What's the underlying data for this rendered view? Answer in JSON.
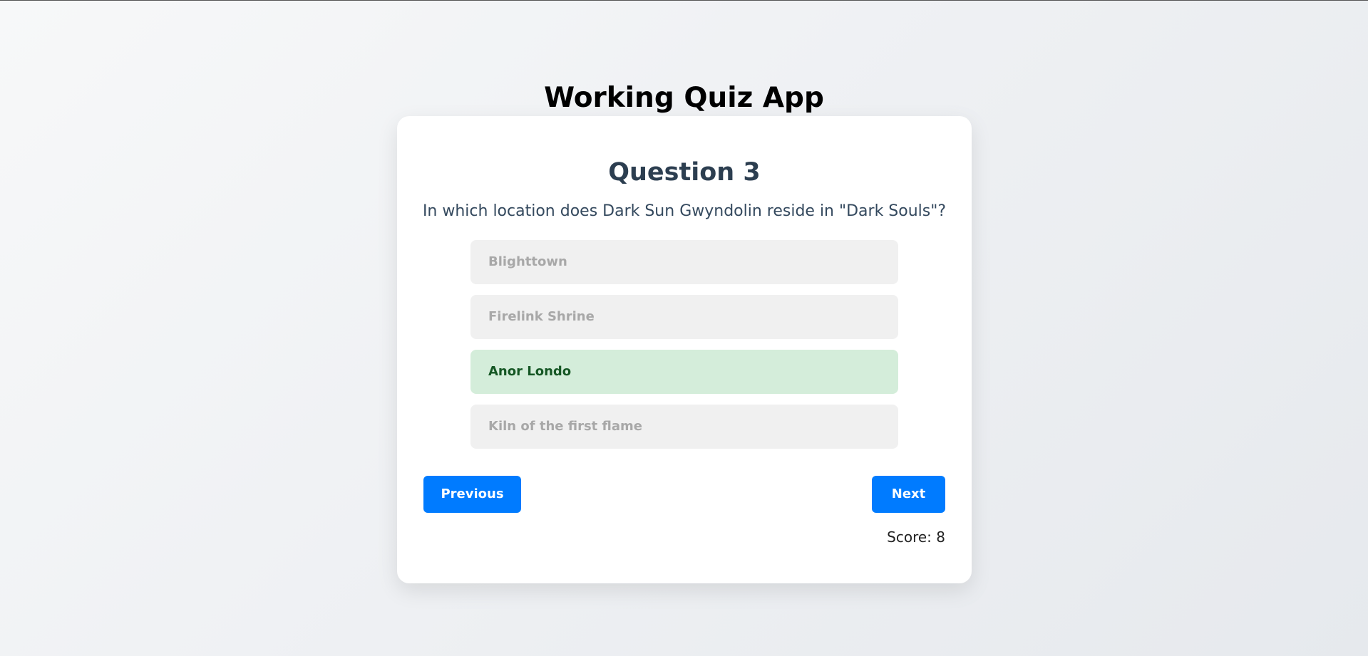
{
  "app": {
    "title": "Working Quiz App"
  },
  "question": {
    "heading": "Question 3",
    "text": "In which location does Dark Sun Gwyndolin reside in \"Dark Souls\"?",
    "options": [
      {
        "label": "Blighttown",
        "state": "disabled"
      },
      {
        "label": "Firelink Shrine",
        "state": "disabled"
      },
      {
        "label": "Anor Londo",
        "state": "correct"
      },
      {
        "label": "Kiln of the first flame",
        "state": "disabled"
      }
    ]
  },
  "navigation": {
    "previous_label": "Previous",
    "next_label": "Next"
  },
  "score": {
    "text": "Score: 8"
  },
  "colors": {
    "accent": "#007bff",
    "correct_bg": "#d4edda",
    "correct_text": "#155724",
    "disabled_bg": "#f0f0f0",
    "disabled_text": "#a8a8a8",
    "heading": "#2c3e50"
  }
}
